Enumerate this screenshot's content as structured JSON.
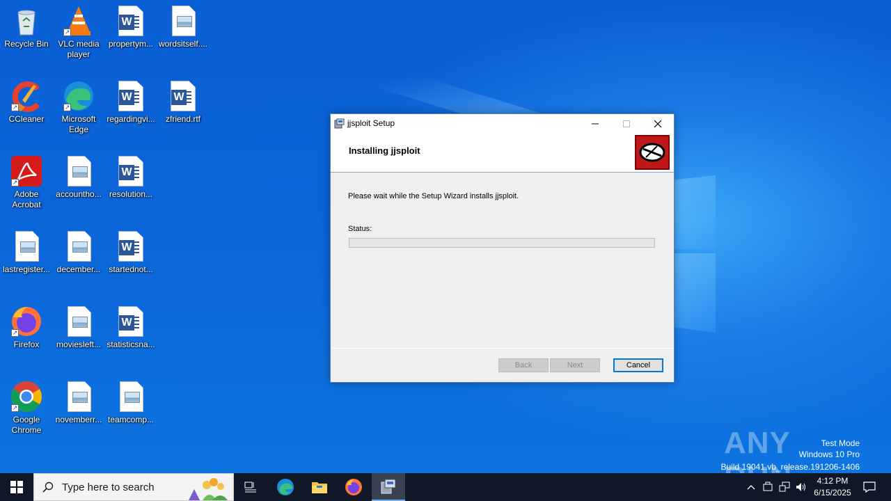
{
  "desktop": {
    "icons": [
      {
        "label": "Recycle Bin",
        "icon": "recycle-bin-icon"
      },
      {
        "label": "VLC media player",
        "icon": "vlc-icon"
      },
      {
        "label": "propertym...",
        "icon": "word-document-icon"
      },
      {
        "label": "wordsitself....",
        "icon": "image-document-icon"
      },
      {
        "label": "CCleaner",
        "icon": "ccleaner-icon"
      },
      {
        "label": "Microsoft Edge",
        "icon": "edge-icon"
      },
      {
        "label": "regardingvi...",
        "icon": "word-document-icon"
      },
      {
        "label": "zfriend.rtf",
        "icon": "word-document-icon"
      },
      {
        "label": "Adobe Acrobat",
        "icon": "acrobat-icon"
      },
      {
        "label": "accountho...",
        "icon": "image-document-icon"
      },
      {
        "label": "resolution...",
        "icon": "word-document-icon"
      },
      {
        "label": "lastregister...",
        "icon": "image-document-icon"
      },
      {
        "label": "december...",
        "icon": "image-document-icon"
      },
      {
        "label": "startednot...",
        "icon": "word-document-icon"
      },
      {
        "label": "Firefox",
        "icon": "firefox-icon"
      },
      {
        "label": "moviesleft...",
        "icon": "image-document-icon"
      },
      {
        "label": "statisticsna...",
        "icon": "word-document-icon"
      },
      {
        "label": "Google Chrome",
        "icon": "chrome-icon"
      },
      {
        "label": "novemberr...",
        "icon": "image-document-icon"
      },
      {
        "label": "teamcomp...",
        "icon": "image-document-icon"
      }
    ]
  },
  "dialog": {
    "title": "jjsploit Setup",
    "heading": "Installing jjsploit",
    "body_text": "Please wait while the Setup Wizard installs jjsploit.",
    "status_label": "Status:",
    "progress": 0,
    "buttons": {
      "back": "Back",
      "next": "Next",
      "cancel": "Cancel"
    }
  },
  "taskbar": {
    "search_placeholder": "Type here to search",
    "time": "4:12 PM",
    "date": "6/15/2025",
    "pinned": [
      "task-view-icon",
      "edge-icon",
      "file-explorer-icon",
      "firefox-icon",
      "installer-icon"
    ]
  },
  "watermark": {
    "brand": "ANY RUN",
    "mode": "Test Mode",
    "edition": "Windows 10 Pro",
    "build": "Build 19041.vb_release.191206-1406"
  },
  "colors": {
    "desktop_blue": "#0b62d6",
    "taskbar": "#101726",
    "dialog_bg": "#f0f0f0",
    "accent": "#0078d7"
  }
}
